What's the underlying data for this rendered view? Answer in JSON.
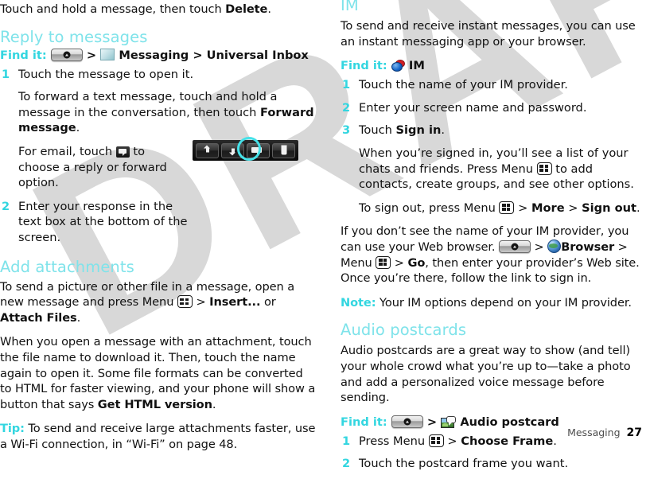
{
  "footer": {
    "section": "Messaging",
    "page": "27"
  },
  "left_column": {
    "intro_line": {
      "pre": "Touch and hold a message, then touch ",
      "bold": "Delete",
      "post": "."
    },
    "reply_section": {
      "heading": "Reply to messages",
      "findit": {
        "label": "Find it:",
        "home_icon": "home-key-icon",
        "sep1": ">",
        "app_icon": "envelope-icon",
        "app": "Messaging",
        "sep2": ">",
        "target": "Universal Inbox"
      },
      "step1": {
        "num": "1",
        "text": "Touch the message to open it."
      },
      "step1_note": {
        "pre": "To forward a text message, touch and hold a message in the conversation, then touch ",
        "bold": "Forward message",
        "post": "."
      },
      "step1_email": {
        "pre": "For email, touch ",
        "icon": "reply-bubble-icon",
        "post": " to choose a reply or forward option."
      },
      "step2": {
        "num": "2",
        "text": "Enter your response in the text box at the bottom of the screen."
      },
      "figure": {
        "name": "email-action-toolbar",
        "buttons": [
          {
            "name": "previous-message-button",
            "icon": "arrow-up-icon",
            "selected": false
          },
          {
            "name": "next-message-button",
            "icon": "arrow-down-icon",
            "selected": false
          },
          {
            "name": "reply-button",
            "icon": "speech-bubble-icon",
            "selected": true
          },
          {
            "name": "delete-button",
            "icon": "trash-icon",
            "selected": false
          }
        ]
      }
    },
    "attachments_section": {
      "heading": "Add attachments",
      "para1": {
        "pre": "To send a picture or other file in a message, open a new message and press Menu ",
        "icon": "menu-key-icon",
        "mid": " > ",
        "bold1": "Insert...",
        "mid2": " or ",
        "bold2": "Attach Files",
        "post": "."
      },
      "para2": {
        "pre": "When you open a message with an attachment, touch the file name to download it. Then, touch the name again to open it. Some file formats can be converted to HTML for faster viewing, and your phone will show a button that says ",
        "bold": "Get HTML version",
        "post": "."
      },
      "tip": {
        "label": "Tip:",
        "text": " To send and receive large attachments faster, use a Wi-Fi connection, in “Wi-Fi” on page 48."
      }
    }
  },
  "right_column": {
    "im_section": {
      "heading": "IM",
      "para1": "To send and receive instant messages, you can use an instant messaging app or your browser.",
      "findit": {
        "label": "Find it:",
        "app_icon": "im-bubbles-icon",
        "app": "IM"
      },
      "step1": {
        "num": "1",
        "text": "Touch the name of your IM provider."
      },
      "step2": {
        "num": "2",
        "text": "Enter your screen name and password."
      },
      "step3": {
        "num": "3",
        "pre": "Touch ",
        "bold": "Sign in",
        "post": "."
      },
      "step3_note1": {
        "pre": "When you’re signed in, you’ll see a list of your chats and friends. Press Menu ",
        "icon": "menu-key-icon",
        "post": " to add contacts, create groups, and see other options."
      },
      "step3_note2": {
        "pre": "To sign out, press Menu ",
        "icon": "menu-key-icon",
        "mid": " > ",
        "bold1": "More",
        "mid2": " > ",
        "bold2": "Sign out",
        "post": "."
      },
      "para_browser": {
        "pre": "If you don’t see the name of your IM provider, you can use your Web browser. ",
        "home_icon": "home-key-icon",
        "sep1": " > ",
        "globe_icon": "globe-icon",
        "bold1": "Browser",
        "sep2": " > Menu ",
        "menu_icon": "menu-key-icon",
        "sep3": " > ",
        "bold2": "Go",
        "post": ", then enter your provider’s Web site. Once you’re there, follow the link to sign in."
      },
      "note": {
        "label": "Note:",
        "text": " Your IM options depend on your IM provider."
      }
    },
    "audio_section": {
      "heading": "Audio postcards",
      "para1": "Audio postcards are a great way to show (and tell) your whole crowd what you’re up to—take a photo and add a personalized voice message before sending.",
      "findit": {
        "label": "Find it:",
        "home_icon": "home-key-icon",
        "sep1": ">",
        "app_icon": "postcard-icon",
        "app": "Audio postcard"
      },
      "step1": {
        "num": "1",
        "pre": "Press Menu ",
        "icon": "menu-key-icon",
        "mid": " > ",
        "bold": "Choose Frame",
        "post": "."
      },
      "step2": {
        "num": "2",
        "text": "Touch the postcard frame you want."
      }
    }
  },
  "watermark": {
    "text": "DRAFT",
    "color": "#d6d6d6"
  }
}
